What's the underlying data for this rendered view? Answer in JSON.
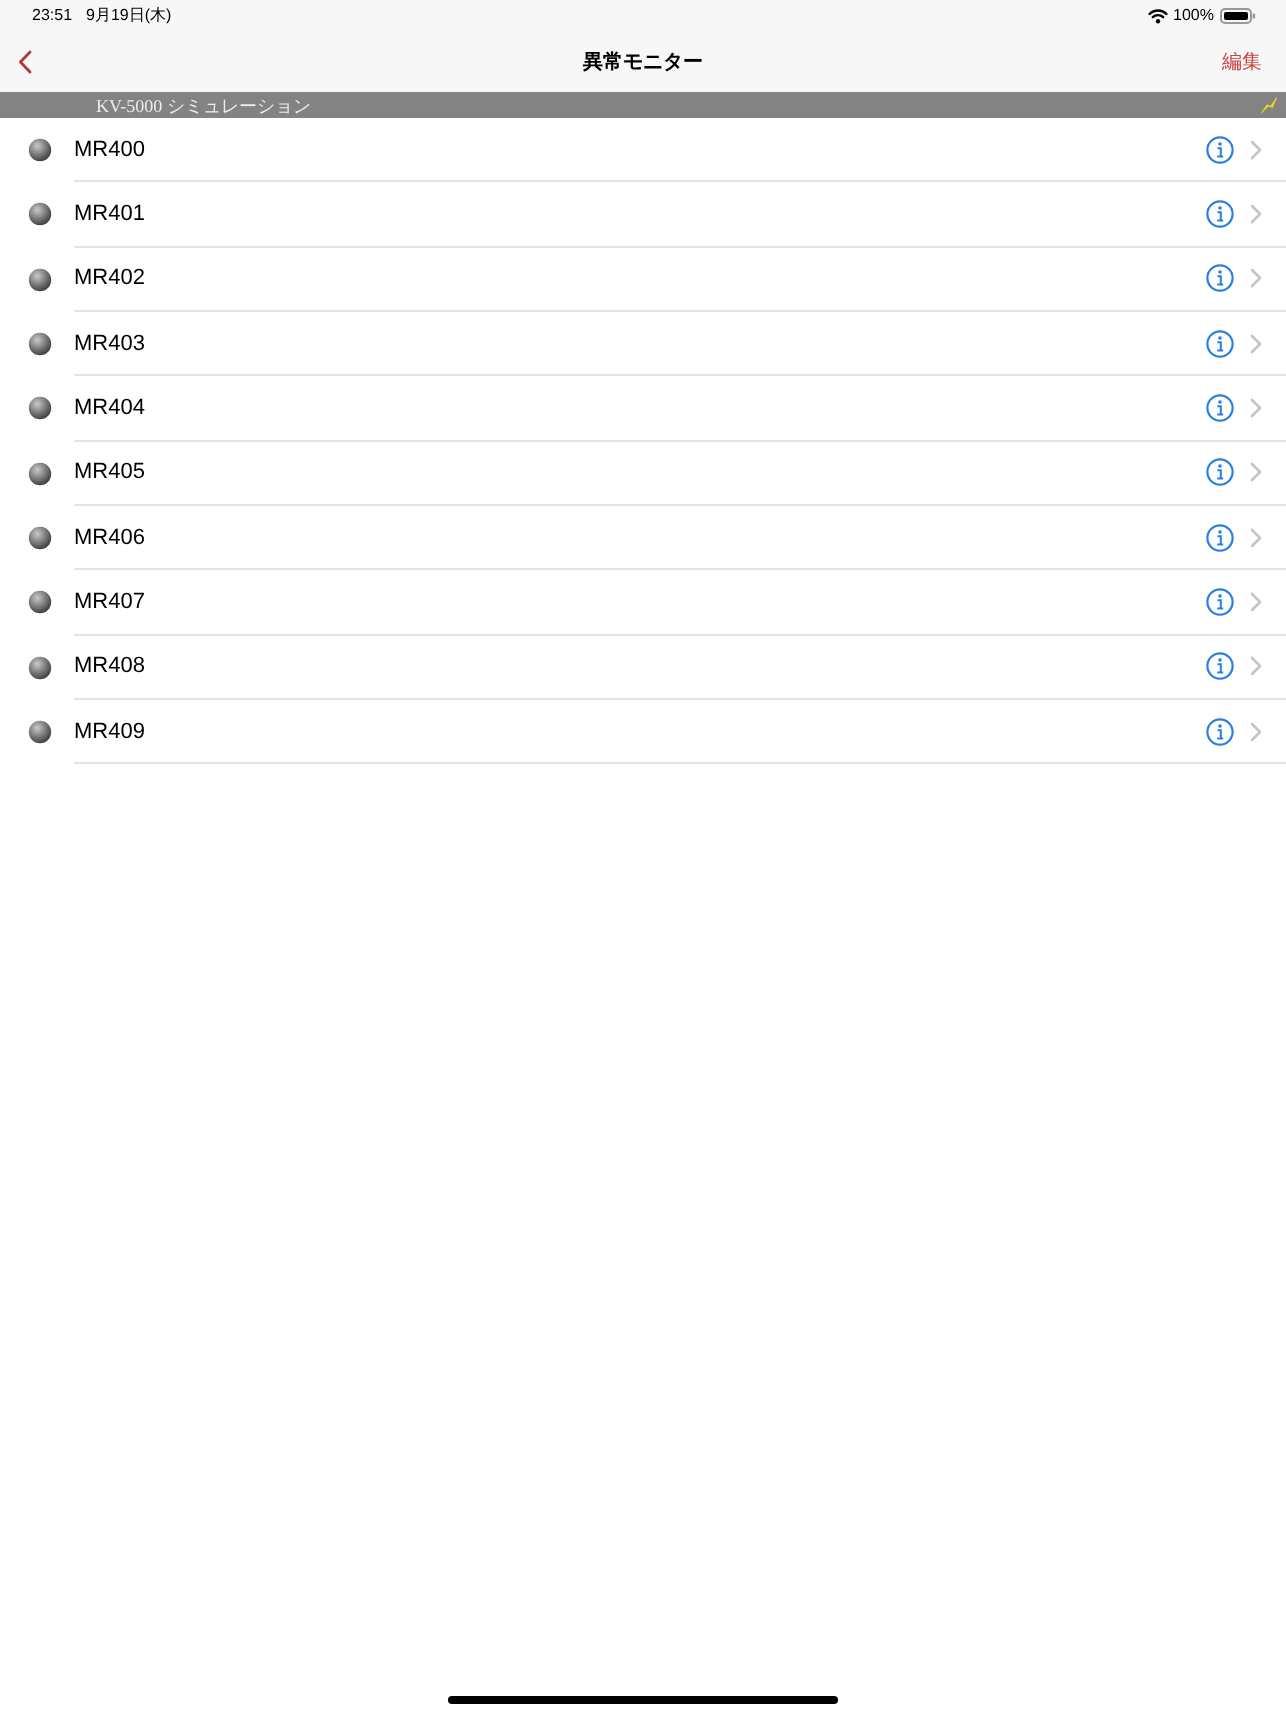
{
  "status_bar": {
    "time": "23:51",
    "date": "9月19日(木)",
    "battery": "100%"
  },
  "nav_bar": {
    "title": "異常モニター",
    "edit": "編集"
  },
  "banner": {
    "text": "KV-5000 シミュレーション"
  },
  "monitors": [
    {
      "name": "MR400"
    },
    {
      "name": "MR401"
    },
    {
      "name": "MR402"
    },
    {
      "name": "MR403"
    },
    {
      "name": "MR404"
    },
    {
      "name": "MR405"
    },
    {
      "name": "MR406"
    },
    {
      "name": "MR407"
    },
    {
      "name": "MR408"
    },
    {
      "name": "MR409"
    }
  ]
}
